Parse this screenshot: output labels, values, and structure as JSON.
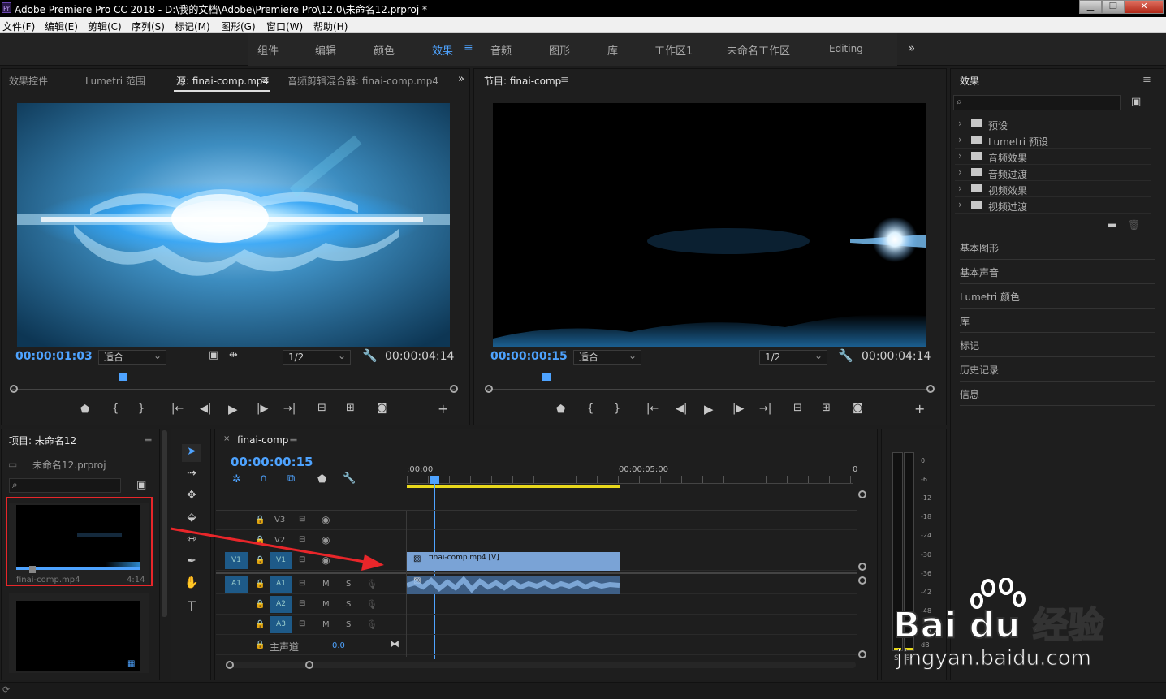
{
  "window": {
    "title": "Adobe Premiere Pro CC 2018 - D:\\我的文档\\Adobe\\Premiere Pro\\12.0\\未命名12.prproj *",
    "app_icon": "Pr",
    "minimize_icon": "minimize-icon",
    "maximize_icon": "maximize-icon",
    "close_icon": "close-icon"
  },
  "menu": [
    "文件(F)",
    "编辑(E)",
    "剪辑(C)",
    "序列(S)",
    "标记(M)",
    "图形(G)",
    "窗口(W)",
    "帮助(H)"
  ],
  "workspaces": {
    "items": [
      "组件",
      "编辑",
      "颜色",
      "效果",
      "音频",
      "图形",
      "库",
      "工作区1",
      "未命名工作区",
      "Editing"
    ],
    "active": "效果",
    "more": "»"
  },
  "source_panel": {
    "tabs": [
      "效果控件",
      "Lumetri 范围",
      "源: finai-comp.mp4",
      "音频剪辑混合器: finai-comp.mp4"
    ],
    "active_tab": "源: finai-comp.mp4",
    "timecode": "00:00:01:03",
    "fit": "适合",
    "resolution": "1/2",
    "duration": "00:00:04:14",
    "playhead_fraction": 0.245
  },
  "program_panel": {
    "tab": "节目: finai-comp",
    "timecode": "00:00:00:15",
    "fit": "适合",
    "resolution": "1/2",
    "duration": "00:00:04:14",
    "playhead_fraction": 0.13
  },
  "effects_panel": {
    "title": "效果",
    "tree": [
      "预设",
      "Lumetri 预设",
      "音频效果",
      "音频过渡",
      "视频效果",
      "视频过渡"
    ],
    "sections": [
      "基本图形",
      "基本声音",
      "Lumetri 颜色",
      "库",
      "标记",
      "历史记录",
      "信息"
    ]
  },
  "project_panel": {
    "title": "项目: 未命名12",
    "file": "未命名12.prproj",
    "clip_name": "finai-comp.mp4",
    "clip_duration": "4:14"
  },
  "timeline": {
    "tab": "finai-comp",
    "timecode": "00:00:00:15",
    "ruler_labels": [
      ":00:00",
      "00:00:05:00",
      "0"
    ],
    "tracks": [
      {
        "id": "V3",
        "type": "video"
      },
      {
        "id": "V2",
        "type": "video"
      },
      {
        "id": "V1",
        "type": "video",
        "source": "V1"
      },
      {
        "id": "A1",
        "type": "audio",
        "source": "A1"
      },
      {
        "id": "A2",
        "type": "audio"
      },
      {
        "id": "A3",
        "type": "audio"
      }
    ],
    "mute_label": "M",
    "solo_label": "S",
    "master": {
      "label": "主声道",
      "value": "0.0"
    },
    "video_clip": "finai-comp.mp4 [V]"
  },
  "meter": {
    "scale": [
      "0",
      "-6",
      "-12",
      "-18",
      "-24",
      "-30",
      "-36",
      "-42",
      "-48",
      "-54",
      "dB"
    ],
    "s_label": "S"
  },
  "watermark": {
    "brand": "Bai du 经验",
    "url": "jingyan.baidu.com"
  },
  "colors": {
    "accent_blue": "#4ea3ff",
    "clip_video": "#7aa3d6",
    "clip_audio": "#3e5f86",
    "annotation_red": "#e8262a",
    "work_area_yellow": "#e8d81c"
  }
}
